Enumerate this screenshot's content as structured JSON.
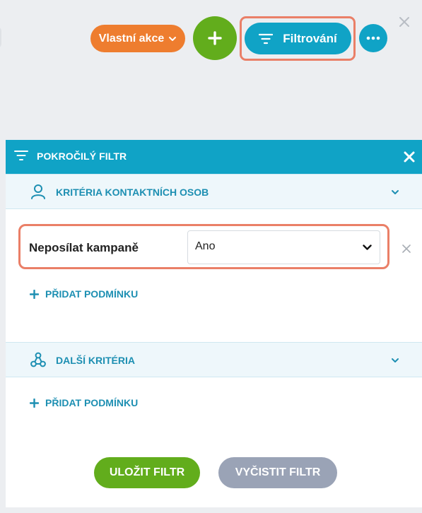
{
  "toolbar": {
    "custom_action_label": "Vlastní akce",
    "add_icon": "plus-icon",
    "filter_label": "Filtrování",
    "filter_icon": "filter-lines-icon",
    "more_icon": "more-dots-icon",
    "close_icon": "close-icon"
  },
  "panel": {
    "title": "POKROČILÝ FILTR",
    "sections": [
      {
        "title": "KRITÉRIA KONTAKTNÍCH OSOB",
        "icon": "user-icon",
        "conditions": [
          {
            "label": "Neposílat kampaně",
            "value": "Ano"
          }
        ],
        "add_label": "PŘIDAT PODMÍNKU"
      },
      {
        "title": "DALŠÍ KRITÉRIA",
        "icon": "share-nodes-icon",
        "conditions": [],
        "add_label": "PŘIDAT PODMÍNKU"
      }
    ],
    "save_label": "ULOŽIT FILTR",
    "clear_label": "VYČISTIT FILTR"
  },
  "colors": {
    "primary": "#10a3c6",
    "success": "#62ad1c",
    "orange": "#ee7d2f",
    "muted": "#9aa3b6",
    "highlight": "#ea7f67"
  }
}
